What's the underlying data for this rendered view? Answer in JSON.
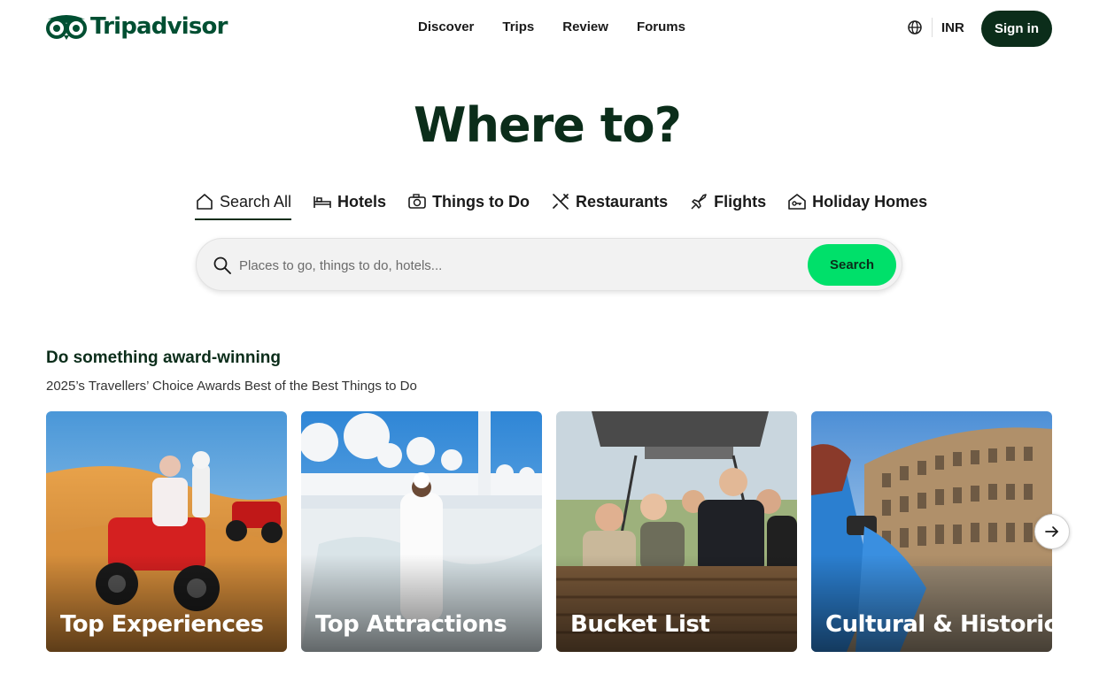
{
  "header": {
    "logo_text": "Tripadvisor",
    "nav": [
      "Discover",
      "Trips",
      "Review",
      "Forums"
    ],
    "currency": "INR",
    "sign_in_label": "Sign in"
  },
  "hero": {
    "title": "Where to?",
    "tabs": [
      {
        "label": "Search All",
        "icon": "home-icon",
        "active": true
      },
      {
        "label": "Hotels",
        "icon": "bed-icon"
      },
      {
        "label": "Things to Do",
        "icon": "camera-icon"
      },
      {
        "label": "Restaurants",
        "icon": "utensils-icon"
      },
      {
        "label": "Flights",
        "icon": "plane-icon"
      },
      {
        "label": "Holiday Homes",
        "icon": "house-key-icon"
      }
    ],
    "search": {
      "placeholder": "Places to go, things to do, hotels...",
      "button_label": "Search"
    }
  },
  "section": {
    "title": "Do something award-winning",
    "subtitle": "2025’s Travellers’ Choice Awards Best of the Best Things to Do",
    "cards": [
      {
        "label": "Top Experiences"
      },
      {
        "label": "Top Attractions"
      },
      {
        "label": "Bucket List"
      },
      {
        "label": "Cultural & Historic"
      }
    ]
  },
  "colors": {
    "brand_dark": "#0b2d1a",
    "search_button": "#00e06a"
  }
}
